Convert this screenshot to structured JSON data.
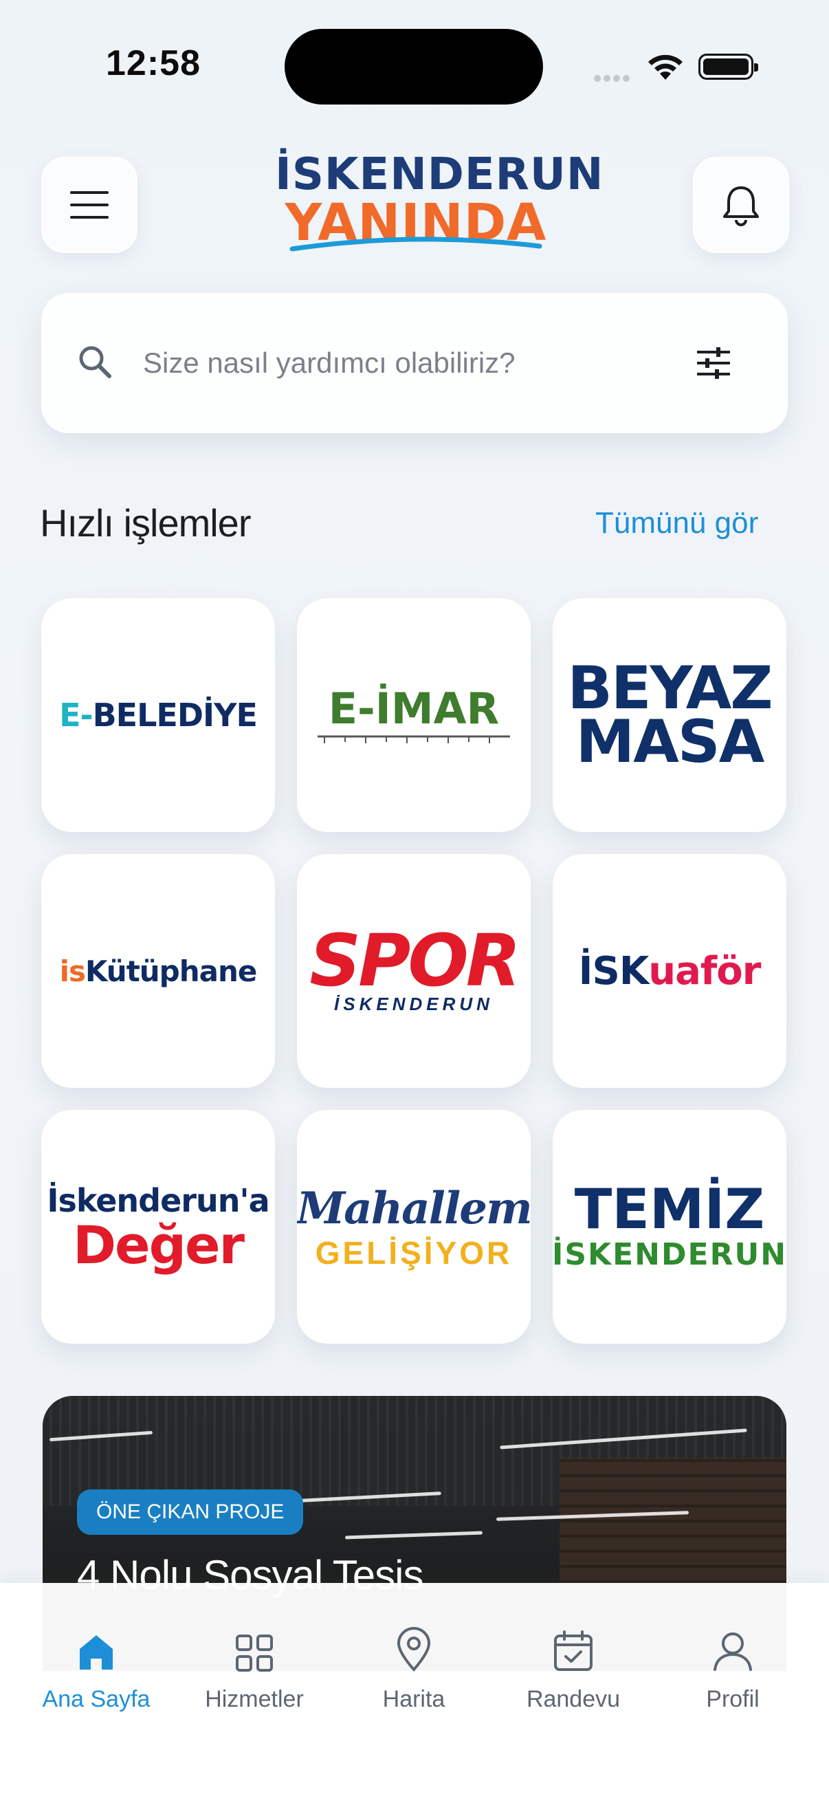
{
  "status_bar": {
    "time": "12:58"
  },
  "header": {
    "logo_line1": "İSKENDERUN",
    "logo_line2": "YANINDA",
    "menu_icon": "hamburger-menu-icon",
    "notification_icon": "bell-icon"
  },
  "search": {
    "placeholder": "Size nasıl yardımcı olabiliriz?",
    "icon": "search-icon",
    "filter_icon": "sliders-icon"
  },
  "quick_actions": {
    "title": "Hızlı işlemler",
    "see_all": "Tümünü gör",
    "tiles": {
      "ebelediye": {
        "prefix": "E-",
        "name": "BELEDİYE"
      },
      "eimar": {
        "name": "E-İMAR"
      },
      "beyazmasa": {
        "line1": "BEYAZ",
        "line2": "MASA"
      },
      "kutuphane": {
        "prefix": "is",
        "name": "Kütüphane"
      },
      "spor": {
        "name": "SPOR",
        "sub": "İSKENDERUN"
      },
      "kuafor": {
        "prefix": "İSK",
        "name": "uaför"
      },
      "deger": {
        "line1": "İskenderun'a",
        "line2": "Değer"
      },
      "mahallem": {
        "line1": "Mahallem",
        "line2": "GELİŞİYOR"
      },
      "temiz": {
        "line1": "TEMİZ",
        "line2": "İSKENDERUN"
      }
    }
  },
  "featured": {
    "badge": "ÖNE ÇIKAN PROJE",
    "title": "4 Nolu Sosyal Tesis"
  },
  "tabbar": {
    "active": "home",
    "items": [
      {
        "label": "Ana Sayfa",
        "icon": "home-icon"
      },
      {
        "label": "Hizmetler",
        "icon": "grid-icon"
      },
      {
        "label": "Harita",
        "icon": "map-pin-icon"
      },
      {
        "label": "Randevu",
        "icon": "calendar-check-icon"
      },
      {
        "label": "Profil",
        "icon": "user-icon"
      }
    ]
  },
  "colors": {
    "accent": "#1e8fd6",
    "brand_navy": "#10306a",
    "brand_orange": "#f06a2a"
  }
}
